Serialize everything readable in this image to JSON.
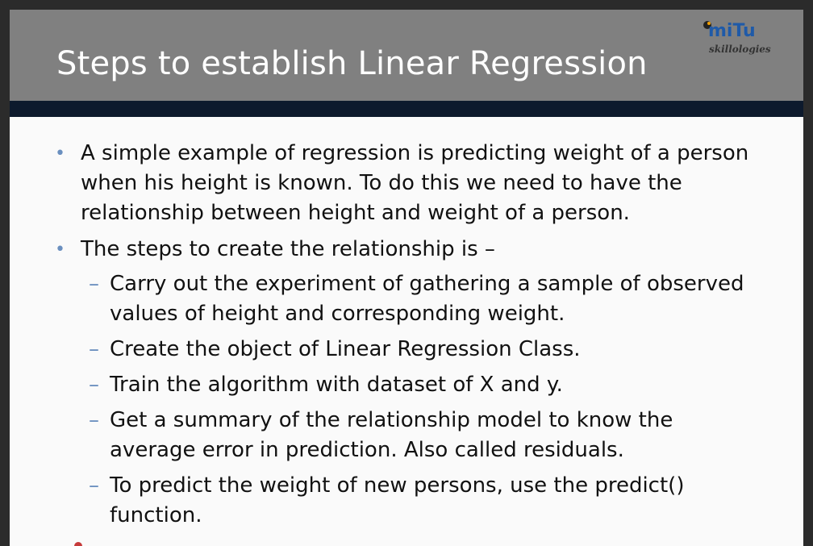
{
  "slide": {
    "title": "Steps to establish Linear Regression",
    "logo": {
      "word": "miTu",
      "sub": "skillologies"
    },
    "bullets": [
      "A simple example of regression is predicting weight of a person when his height is known. To do this we need to have the relationship between height and weight of a person.",
      "The steps to create the relationship is –"
    ],
    "steps": [
      "Carry out the experiment of gathering a sample of observed values of height and corresponding weight.",
      "Create the object of Linear Regression Class.",
      "Train the algorithm with dataset of X and y.",
      "Get a summary of the relationship model to know the average error in prediction. Also called residuals.",
      "To predict the weight of new persons, use the predict() function."
    ]
  },
  "colors": {
    "title_bar": "#808080",
    "accent_bar": "#0d1a2d",
    "bullet_marker": "#6a8fbf",
    "logo_blue": "#1f5aa8"
  },
  "icons": {
    "bullet": "bullet-dot",
    "step": "en-dash"
  }
}
